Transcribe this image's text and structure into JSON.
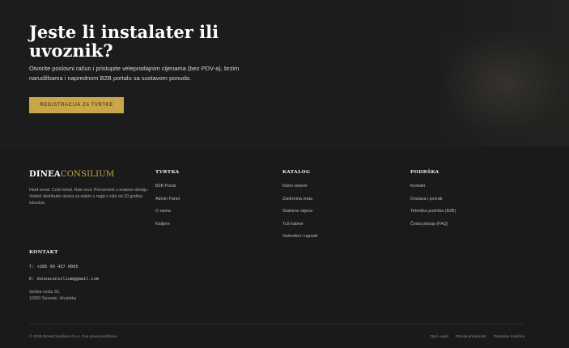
{
  "hero": {
    "title": "Jeste li instalater ili uvoznik?",
    "text": "Otvorite poslovni račun i pristupite veleprodajnim cijenama (bez PDV-a), brzim narudžbama i naprednom B2B portalu sa sustavom ponuda.",
    "button_label": "Registracija za tvrtke",
    "accent_color": "#c9a649"
  },
  "brand": {
    "name_part1": "DINEA",
    "name_part2": "CONSILIUM",
    "description": "Hard wood. Cold metal. Raw soul. Precizmost u svakom detalju. Vodeći distributer okova za staklo u regiji s više od 10 godina iskustva."
  },
  "columns": {
    "company": {
      "title": "TVRTKA",
      "items": [
        "B2B Portal",
        "Admin Panel",
        "O nama",
        "Katijere"
      ]
    },
    "catalog": {
      "title": "KATALOG",
      "items": [
        "Klizni sistemi",
        "Zaokretna vrata",
        "Staklene stijene",
        "Tuš kabine",
        "Gelenderi i ograde"
      ]
    },
    "support": {
      "title": "PODRŠKA",
      "items": [
        "Kontakt",
        "Dostava i povrati",
        "Tehnička podrška (B2B)",
        "Česta pitanja (FAQ)"
      ]
    }
  },
  "contact": {
    "title": "KONTAKT",
    "phone": "T: +385 99 437 0065",
    "email": "E: dineaconsilium@gmail.com",
    "address_line1": "Selska cesta 33,",
    "address_line2": "10360 Sesvete, Hrvatska"
  },
  "bottom": {
    "copyright": "© 2026 DineaConsilium d.o.o. Sva prava pridržana.",
    "links": [
      "Opći uvjeti",
      "Pravila privatnosti",
      "Postavke kolačića"
    ]
  }
}
